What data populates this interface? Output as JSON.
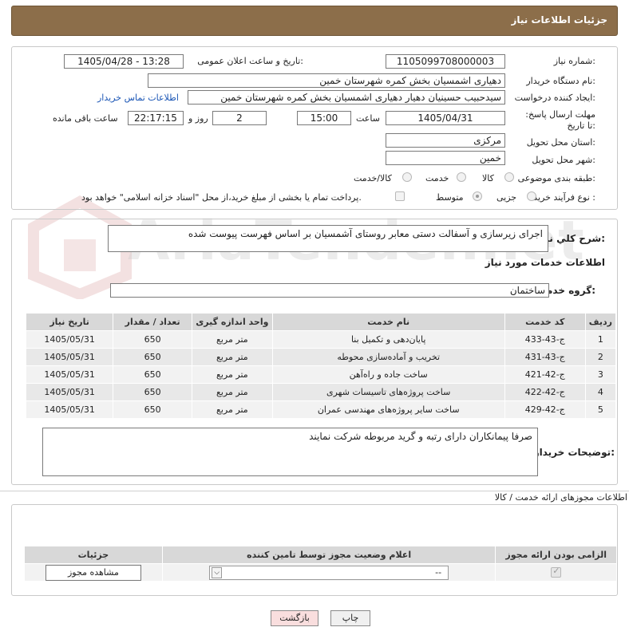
{
  "header": {
    "title": "جزئیات اطلاعات نیاز"
  },
  "form": {
    "need_number_label": "شماره نیاز:",
    "need_number": "1105099708000003",
    "announce_label": "تاریخ و ساعت اعلان عمومی:",
    "announce_value": "1405/04/28 - 13:28",
    "buyer_org_label": "نام دستگاه خریدار:",
    "buyer_org": "دهیاری اشمسیان بخش کمره شهرستان خمین",
    "creator_label": "ایجاد کننده درخواست:",
    "creator": "سیدحبیب حسینیان دهیار دهیاری اشمسیان بخش کمره شهرستان خمین",
    "contact_link": "اطلاعات تماس خریدار",
    "deadline_label": "مهلت ارسال پاسخ: تا تاریخ:",
    "deadline_date": "1405/04/31",
    "time_label": "ساعت",
    "deadline_time": "15:00",
    "days_value": "2",
    "days_label": "روز و",
    "remaining_time": "22:17:15",
    "remaining_label": "ساعت باقی مانده",
    "province_label": "استان محل تحویل:",
    "province": "مرکزی",
    "city_label": "شهر محل تحویل:",
    "city": "خمین",
    "category_label": "طبقه بندی موضوعی:",
    "category_options": [
      "کالا",
      "خدمت",
      "کالا/خدمت"
    ],
    "process_label": "نوع فرآیند خرید :",
    "process_options": [
      "جزیی",
      "متوسط"
    ],
    "payment_note": "پرداخت تمام یا بخشی از مبلغ خرید،از محل \"اسناد خزانه اسلامی\" خواهد بود."
  },
  "description": {
    "label": "شرح کلي نياز:",
    "value": "اجرای زیرسازی و آسفالت دستی معابر روستای آشمسیان بر اساس فهرست پیوست شده"
  },
  "services": {
    "section_title": "اطلاعات خدمات مورد نیاز",
    "group_label": "گروه خدمت:",
    "group_value": "ساختمان",
    "columns": [
      "ردیف",
      "کد خدمت",
      "نام خدمت",
      "واحد اندازه گیری",
      "تعداد / مقدار",
      "تاریخ نیاز"
    ],
    "rows": [
      [
        "1",
        "ج-43-433",
        "پایان‌دهی و تکمیل بنا",
        "متر مربع",
        "650",
        "1405/05/31"
      ],
      [
        "2",
        "ج-43-431",
        "تخریب و آماده‌سازی محوطه",
        "متر مربع",
        "650",
        "1405/05/31"
      ],
      [
        "3",
        "ج-42-421",
        "ساخت جاده و راه‌آهن",
        "متر مربع",
        "650",
        "1405/05/31"
      ],
      [
        "4",
        "ج-42-422",
        "ساخت پروژه‌های تاسیسات شهری",
        "متر مربع",
        "650",
        "1405/05/31"
      ],
      [
        "5",
        "ج-42-429",
        "ساخت سایر پروژه‌های مهندسی عمران",
        "متر مربع",
        "650",
        "1405/05/31"
      ]
    ]
  },
  "buyer_notes": {
    "label": "توضیحات خریدار:",
    "value": "صرفا پیمانکاران دارای رتبه و گرید مربوطه شرکت نمایند"
  },
  "permits": {
    "section_title": "اطلاعات مجوزهای ارائه خدمت / کالا",
    "columns": [
      "الزامی بودن ارائه مجوز",
      "اعلام وضعیت مجوز توسط تامین کننده",
      "جزئیات"
    ],
    "select_value": "--",
    "view_button": "مشاهده مجوز"
  },
  "footer": {
    "print_button": "چاپ",
    "back_button": "بازگشت"
  },
  "watermark": {
    "text": "AriaTender.net"
  },
  "colors": {
    "header_bg": "#8c6e4a",
    "link": "#1a55b5",
    "back_button_bg": "#f9dede"
  }
}
